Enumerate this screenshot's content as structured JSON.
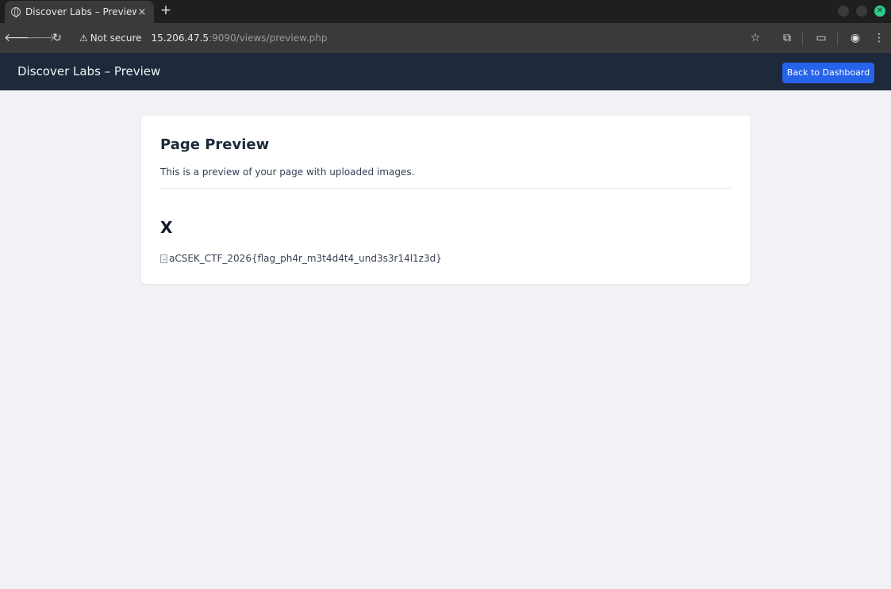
{
  "browser": {
    "tab_title": "Discover Labs – Preview",
    "tab_close": "×",
    "new_tab": "+",
    "security_label": "Not secure",
    "url_host": "15.206.47.5",
    "url_rest": ":9090/views/preview.php"
  },
  "app": {
    "title": "Discover Labs – Preview",
    "back_button": "Back to Dashboard"
  },
  "card": {
    "heading": "Page Preview",
    "description": "This is a preview of your page with uploaded images.",
    "page_name": "X",
    "image_alt": "aCSEK_CTF_2026{flag_ph4r_m3t4d4t4_und3s3r14l1z3d}"
  },
  "colors": {
    "appbar": "#1e293b",
    "accent": "#2563eb",
    "background": "#f0f2f5"
  }
}
